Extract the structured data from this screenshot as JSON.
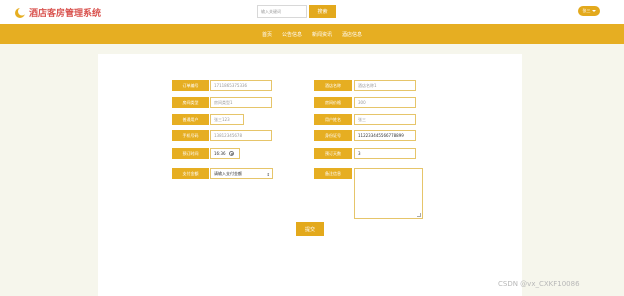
{
  "header": {
    "title": "酒店客房管理系统",
    "search_placeholder": "输入关键词",
    "search_button": "搜索",
    "user_label": "张三"
  },
  "nav": {
    "items": [
      {
        "label": "首页"
      },
      {
        "label": "公告信息"
      },
      {
        "label": "新闻资讯"
      },
      {
        "label": "酒店信息"
      }
    ]
  },
  "form": {
    "rows": [
      {
        "left_label": "订单编号",
        "left_value": "1711865375336",
        "right_label": "酒店名称",
        "right_value": "酒店名称1"
      },
      {
        "left_label": "房间类型",
        "left_value": "房间类型1",
        "right_label": "房间价格",
        "right_value": "300"
      },
      {
        "left_label": "普通用户",
        "left_value": "张三123",
        "right_label": "用户姓名",
        "right_value": "张三"
      },
      {
        "left_label": "手机号码",
        "left_value": "13812345678",
        "right_label": "身份证号",
        "right_value": "112233445566778899"
      },
      {
        "left_label": "预订时间",
        "left_value": "16:36",
        "right_label": "预订天数",
        "right_value": "3"
      },
      {
        "left_label": "支付金额",
        "left_placeholder": "请输入支付金额",
        "right_label": "备注信息"
      }
    ],
    "submit_label": "提交"
  },
  "watermark": "CSDN @vx_CXKF10086",
  "colors": {
    "brand": "#e6ae22",
    "title": "#d9534f"
  }
}
